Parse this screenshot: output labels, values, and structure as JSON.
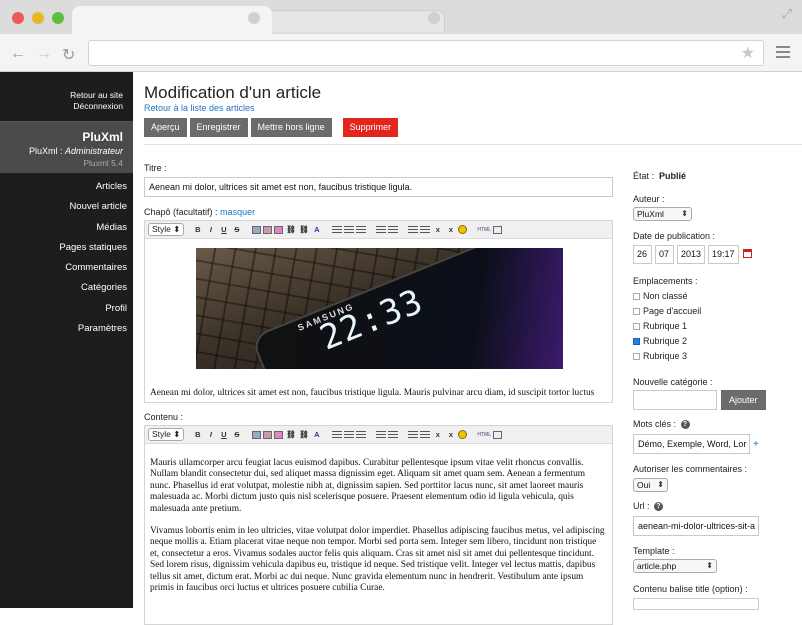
{
  "sidebar": {
    "back_to_site": "Retour au site",
    "logout": "Déconnexion",
    "app_name": "PluXml",
    "user_prefix": "PluXml :",
    "user_role": "Administrateur",
    "version": "Pluxml 5.4",
    "menu": [
      "Articles",
      "Nouvel article",
      "Médias",
      "Pages statiques",
      "Commentaires",
      "Catégories",
      "Profil",
      "Paramètres"
    ]
  },
  "header": {
    "title": "Modification d'un article",
    "back_link": "Retour à la liste des articles",
    "buttons": {
      "preview": "Aperçu",
      "save": "Enregistrer",
      "offline": "Mettre hors ligne",
      "delete": "Supprimer"
    }
  },
  "form": {
    "title_label": "Titre :",
    "title_value": "Aenean mi dolor, ultrices sit amet est non, faucibus tristique ligula.",
    "chapo_label": "Chapô (facultatif) :",
    "chapo_toggle": "masquer",
    "editor_style": "Style",
    "chapo_text": "Aenean mi dolor, ultrices sit amet est non, faucibus tristique ligula. Mauris pulvinar arcu diam, id suscipit tortor luctus",
    "image_text": {
      "brand": "SAMSUNG",
      "time": "22:33"
    },
    "content_label": "Contenu :",
    "content_paragraphs": [
      "Mauris ullamcorper arcu feugiat lacus euismod dapibus. Curabitur pellentesque ipsum vitae velit rhoncus convallis. Nullam blandit consectetur dui, sed aliquet massa dignissim eget. Aliquam sit amet quam sem. Aenean a fermentum nunc. Phasellus id erat volutpat, molestie nibh at, dignissim sapien. Sed porttitor lacus nunc, sit amet laoreet mauris malesuada ac. Morbi dictum justo quis nisl scelerisque posuere. Praesent elementum odio id ligula vehicula, quis malesuada ante pretium.",
      "Vivamus lobortis enim in leo ultricies, vitae volutpat dolor imperdiet. Phasellus adipiscing faucibus metus, vel adipiscing neque mollis a. Etiam placerat vitae neque non tempor. Morbi sed porta sem. Integer sem libero, tincidunt non tristique et, consectetur a eros. Vivamus sodales auctor felis quis aliquam. Cras sit amet nisl sit amet dui pellentesque tincidunt. Sed lorem risus, dignissim vehicula dapibus eu, tristique id neque. Sed tristique velit. Integer vel lectus mattis, dapibus tellus sit amet, dictum erat. Morbi ac dui neque. Nunc gravida elementum nunc in hendrerit. Vestibulum ante ipsum primis in faucibus orci luctus et ultrices posuere cubilia Curae."
    ]
  },
  "side": {
    "state_label": "État :",
    "state_value": "Publié",
    "author_label": "Auteur :",
    "author_value": "PluXml",
    "date_label": "Date de publication :",
    "day": "26",
    "month": "07",
    "year": "2013",
    "time": "19:17",
    "locations_label": "Emplacements :",
    "locations": [
      {
        "label": "Non classé",
        "checked": false
      },
      {
        "label": "Page d'accueil",
        "checked": false
      },
      {
        "label": "Rubrique 1",
        "checked": false
      },
      {
        "label": "Rubrique 2",
        "checked": true
      },
      {
        "label": "Rubrique 3",
        "checked": false
      }
    ],
    "new_cat_label": "Nouvelle catégorie :",
    "add_button": "Ajouter",
    "keywords_label": "Mots clés :",
    "keywords_value": "Démo, Exemple, Word, Lor",
    "keywords_add": "+",
    "comments_label": "Autoriser les commentaires :",
    "comments_value": "Oui",
    "url_label": "Url :",
    "url_value": "aenean-mi-dolor-ultrices-sit-a",
    "template_label": "Template :",
    "template_value": "article.php",
    "title_tag_label": "Contenu balise title (option) :",
    "help_glyph": "?"
  },
  "colors": {
    "sidebar_bg": "#1d1d1d",
    "accent_link": "#1f73c5",
    "delete_button": "#e3261d",
    "neutral_button": "#6b6b6b"
  }
}
